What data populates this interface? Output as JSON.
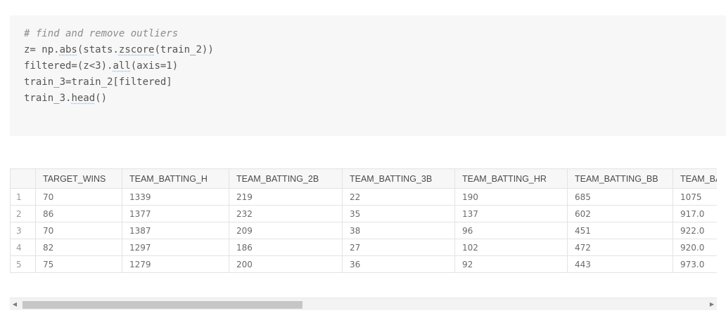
{
  "code_cell": {
    "lines": [
      {
        "kind": "comment",
        "text": "# find and remove outliers"
      },
      {
        "kind": "code",
        "parts": [
          "z= np.",
          "abs",
          "(stats.",
          "zscore",
          "(train_2))"
        ]
      },
      {
        "kind": "code",
        "parts": [
          "filtered=(z<3).",
          "all",
          "(axis=1)"
        ]
      },
      {
        "kind": "code",
        "parts": [
          "train_3=train_2[filtered]"
        ]
      },
      {
        "kind": "code",
        "parts": [
          "train_3.",
          "head",
          "()"
        ]
      }
    ]
  },
  "dataframe": {
    "columns": [
      "",
      "TARGET_WINS",
      "TEAM_BATTING_H",
      "TEAM_BATTING_2B",
      "TEAM_BATTING_3B",
      "TEAM_BATTING_HR",
      "TEAM_BATTING_BB",
      "TEAM_BATTING_SO"
    ],
    "rows": [
      [
        "1",
        "70",
        "1339",
        "219",
        "22",
        "190",
        "685",
        "1075"
      ],
      [
        "2",
        "86",
        "1377",
        "232",
        "35",
        "137",
        "602",
        "917.0"
      ],
      [
        "3",
        "70",
        "1387",
        "209",
        "38",
        "96",
        "451",
        "922.0"
      ],
      [
        "4",
        "82",
        "1297",
        "186",
        "27",
        "102",
        "472",
        "920.0"
      ],
      [
        "5",
        "75",
        "1279",
        "200",
        "36",
        "92",
        "443",
        "973.0"
      ]
    ]
  },
  "scrollbar": {
    "left_arrow": "◀",
    "right_arrow": "▶"
  }
}
